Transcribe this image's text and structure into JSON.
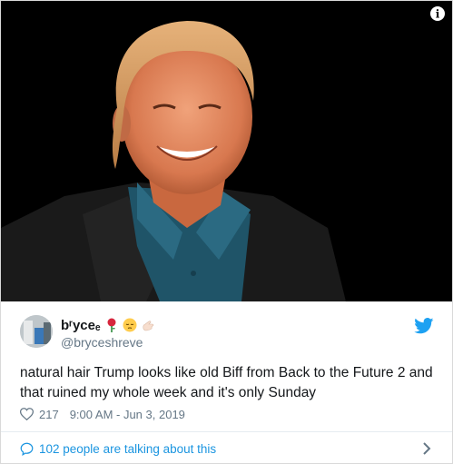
{
  "tweet": {
    "display_name": "bʳyceₑ",
    "handle": "@bryceshreve",
    "text": "natural hair Trump looks like old Biff from Back to the Future 2 and that ruined my whole week and it's only Sunday",
    "likes": "217",
    "timestamp": "9:00 AM - Jun 3, 2019",
    "conversation_label": "102 people are talking about this",
    "info_glyph": "i",
    "emojis": [
      "rose-icon",
      "pensive-face-icon",
      "hand-icon"
    ]
  },
  "colors": {
    "brand": "#1da1f2",
    "link": "#1b95e0",
    "muted": "#657786"
  }
}
